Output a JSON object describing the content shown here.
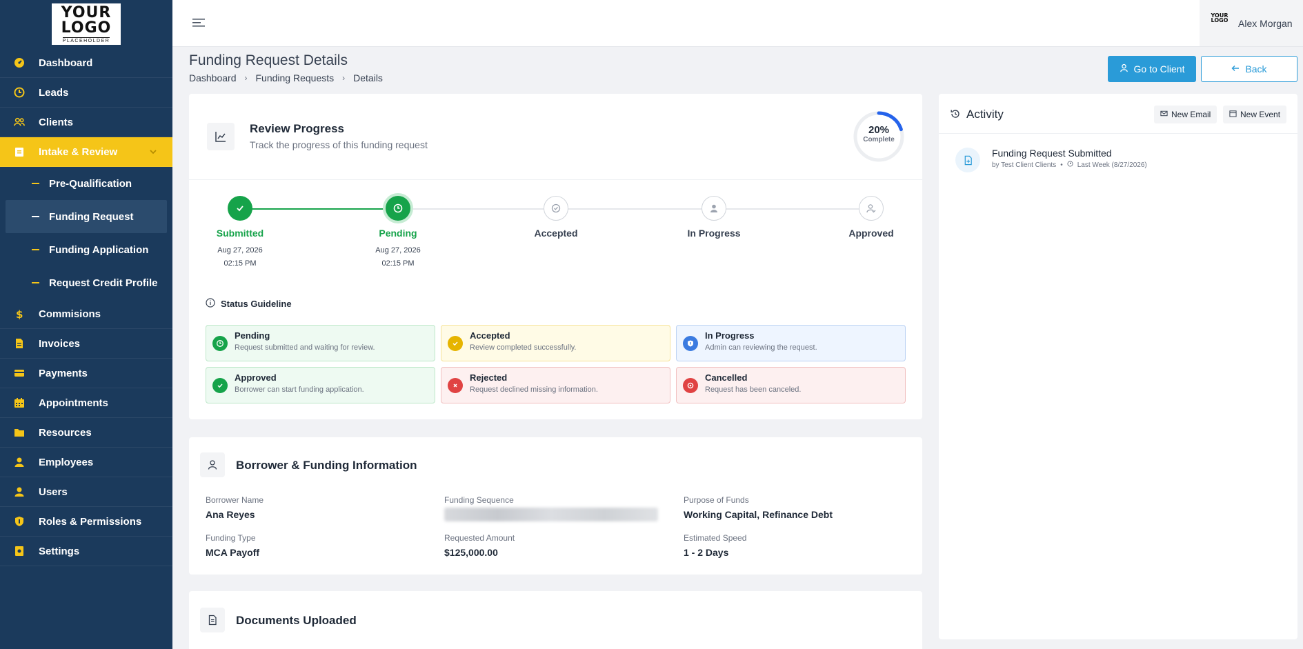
{
  "sidebar": {
    "logo": {
      "line1": "YOUR",
      "line2": "LOGO",
      "line3": "PLACEHOLDER"
    },
    "items": [
      {
        "label": "Dashboard",
        "icon": "dashboard-icon"
      },
      {
        "label": "Leads",
        "icon": "clock-icon"
      },
      {
        "label": "Clients",
        "icon": "users-group-icon"
      },
      {
        "label": "Intake & Review",
        "icon": "clipboard-icon"
      },
      {
        "label": "Commisions",
        "icon": "dollar-icon"
      },
      {
        "label": "Invoices",
        "icon": "invoice-icon"
      },
      {
        "label": "Payments",
        "icon": "credit-card-icon"
      },
      {
        "label": "Appointments",
        "icon": "calendar-icon"
      },
      {
        "label": "Resources",
        "icon": "folder-icon"
      },
      {
        "label": "Employees",
        "icon": "person-icon"
      },
      {
        "label": "Users",
        "icon": "user-icon"
      },
      {
        "label": "Roles & Permissions",
        "icon": "shield-icon"
      },
      {
        "label": "Settings",
        "icon": "settings-icon"
      }
    ],
    "sub_items": [
      {
        "label": "Pre-Qualification"
      },
      {
        "label": "Funding Request"
      },
      {
        "label": "Funding Application"
      },
      {
        "label": "Request Credit Profile"
      }
    ]
  },
  "topbar": {
    "user_logo": {
      "line1": "YOUR",
      "line2": "LOGO"
    },
    "user_name": "Alex Morgan"
  },
  "page": {
    "title": "Funding Request Details",
    "breadcrumb": [
      "Dashboard",
      "Funding Requests",
      "Details"
    ],
    "go_to_client": "Go to Client",
    "back": "Back"
  },
  "review": {
    "title": "Review Progress",
    "subtitle": "Track the progress of this funding request",
    "progress_fraction": 0.2,
    "progress_text": "20%",
    "progress_label": "Complete",
    "steps": [
      {
        "label": "Submitted",
        "date": "Aug 27, 2026",
        "time": "02:15 PM",
        "state": "done"
      },
      {
        "label": "Pending",
        "date": "Aug 27, 2026",
        "time": "02:15 PM",
        "state": "active"
      },
      {
        "label": "Accepted",
        "date": "",
        "time": "",
        "state": "todo"
      },
      {
        "label": "In Progress",
        "date": "",
        "time": "",
        "state": "todo"
      },
      {
        "label": "Approved",
        "date": "",
        "time": "",
        "state": "todo"
      }
    ],
    "guideline_title": "Status Guideline",
    "guidelines": [
      {
        "name": "Pending",
        "desc": "Request submitted and waiting for review.",
        "color": "#16a34a"
      },
      {
        "name": "Accepted",
        "desc": "Review completed successfully.",
        "color": "#e6b400"
      },
      {
        "name": "In Progress",
        "desc": "Admin can reviewing the request.",
        "color": "#3b7be0"
      },
      {
        "name": "Approved",
        "desc": "Borrower can start funding application.",
        "color": "#16a34a"
      },
      {
        "name": "Rejected",
        "desc": "Request declined missing information.",
        "color": "#e04343"
      },
      {
        "name": "Cancelled",
        "desc": "Request has been canceled.",
        "color": "#e04343"
      }
    ]
  },
  "borrower": {
    "title": "Borrower & Funding Information",
    "fields": {
      "borrower_name": {
        "label": "Borrower Name",
        "value": "Ana Reyes"
      },
      "funding_sequence": {
        "label": "Funding Sequence"
      },
      "purpose": {
        "label": "Purpose of Funds",
        "value": "Working Capital, Refinance Debt"
      },
      "funding_type": {
        "label": "Funding Type",
        "value": "MCA Payoff"
      },
      "requested_amount": {
        "label": "Requested Amount",
        "value": "$125,000.00"
      },
      "estimated_speed": {
        "label": "Estimated Speed",
        "value": "1 - 2 Days"
      }
    }
  },
  "documents": {
    "title": "Documents Uploaded"
  },
  "activity": {
    "title": "Activity",
    "new_email": "New Email",
    "new_event": "New Event",
    "items": [
      {
        "title": "Funding Request Submitted",
        "by": "by Test Client Clients",
        "sep": "•",
        "when": "Last Week (8/27/2026)"
      }
    ]
  },
  "colors": {
    "sidebar_bg": "#1b3a5c",
    "accent_yellow": "#f5c518",
    "primary_blue": "#2a9bd8",
    "success_green": "#16a34a"
  }
}
